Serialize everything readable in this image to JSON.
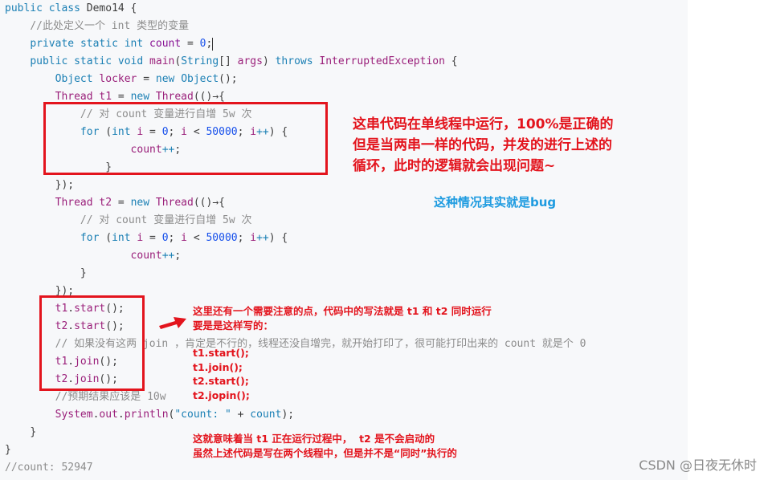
{
  "code": {
    "lines": [
      {
        "indent": 0,
        "tokens": [
          [
            "kw2",
            "public "
          ],
          [
            "kw2",
            "class "
          ],
          [
            "pl",
            "Demo14 {"
          ]
        ]
      },
      {
        "indent": 1,
        "tokens": [
          [
            "cm",
            "//此处定义一个 int 类型的变量"
          ]
        ]
      },
      {
        "indent": 1,
        "tokens": [
          [
            "kw2",
            "private "
          ],
          [
            "kw2",
            "static "
          ],
          [
            "kw2",
            "int "
          ],
          [
            "fld",
            "count"
          ],
          [
            "pl",
            " = "
          ],
          [
            "num",
            "0"
          ],
          [
            "pl",
            ";"
          ]
        ],
        "caret": true
      },
      {
        "indent": 1,
        "tokens": [
          [
            "kw2",
            "public "
          ],
          [
            "kw2",
            "static "
          ],
          [
            "kw2",
            "void "
          ],
          [
            "ty",
            "main"
          ],
          [
            "pl",
            "("
          ],
          [
            "kw2",
            "String"
          ],
          [
            "pl",
            "[] "
          ],
          [
            "ty",
            "args"
          ],
          [
            "pl",
            ") "
          ],
          [
            "kw2",
            "throws "
          ],
          [
            "ty",
            "InterruptedException"
          ],
          [
            "pl",
            " {"
          ]
        ]
      },
      {
        "indent": 2,
        "tokens": [
          [
            "kw2",
            "Object "
          ],
          [
            "ty",
            "locker"
          ],
          [
            "pl",
            " = "
          ],
          [
            "kw2",
            "new "
          ],
          [
            "kw2",
            "Object"
          ],
          [
            "pl",
            "();"
          ]
        ]
      },
      {
        "indent": 2,
        "tokens": [
          [
            "ty",
            "Thread "
          ],
          [
            "ty",
            "t1"
          ],
          [
            "pl",
            " = "
          ],
          [
            "kw2",
            "new "
          ],
          [
            "ty",
            "Thread"
          ],
          [
            "pl",
            "(()→{"
          ]
        ]
      },
      {
        "indent": 3,
        "tokens": [
          [
            "cm",
            "// 对 count 变量进行自增 5w 次"
          ]
        ]
      },
      {
        "indent": 3,
        "tokens": [
          [
            "kw2",
            "for "
          ],
          [
            "pl",
            "("
          ],
          [
            "kw2",
            "int "
          ],
          [
            "ty",
            "i"
          ],
          [
            "pl",
            " = "
          ],
          [
            "num",
            "0"
          ],
          [
            "pl",
            "; "
          ],
          [
            "ty",
            "i"
          ],
          [
            "pl",
            " < "
          ],
          [
            "num",
            "50000"
          ],
          [
            "pl",
            "; "
          ],
          [
            "ty",
            "i"
          ],
          [
            "kw2",
            "++"
          ],
          [
            "pl",
            ") {"
          ]
        ]
      },
      {
        "indent": 5,
        "tokens": [
          [
            "ty",
            "count"
          ],
          [
            "kw2",
            "++"
          ],
          [
            "pl",
            ";"
          ]
        ]
      },
      {
        "indent": 4,
        "tokens": [
          [
            "pl",
            "}"
          ]
        ]
      },
      {
        "indent": 2,
        "tokens": [
          [
            "pl",
            "});"
          ]
        ]
      },
      {
        "indent": 2,
        "tokens": [
          [
            "ty",
            "Thread "
          ],
          [
            "ty",
            "t2"
          ],
          [
            "pl",
            " = "
          ],
          [
            "kw2",
            "new "
          ],
          [
            "ty",
            "Thread"
          ],
          [
            "pl",
            "(()→{"
          ]
        ]
      },
      {
        "indent": 3,
        "tokens": [
          [
            "cm",
            "// 对 count 变量进行自增 5w 次"
          ]
        ]
      },
      {
        "indent": 3,
        "tokens": [
          [
            "kw2",
            "for "
          ],
          [
            "pl",
            "("
          ],
          [
            "kw2",
            "int "
          ],
          [
            "ty",
            "i"
          ],
          [
            "pl",
            " = "
          ],
          [
            "num",
            "0"
          ],
          [
            "pl",
            "; "
          ],
          [
            "ty",
            "i"
          ],
          [
            "pl",
            " < "
          ],
          [
            "num",
            "50000"
          ],
          [
            "pl",
            "; "
          ],
          [
            "ty",
            "i"
          ],
          [
            "kw2",
            "++"
          ],
          [
            "pl",
            ") {"
          ]
        ]
      },
      {
        "indent": 5,
        "tokens": [
          [
            "ty",
            "count"
          ],
          [
            "kw2",
            "++"
          ],
          [
            "pl",
            ";"
          ]
        ]
      },
      {
        "indent": 3,
        "tokens": [
          [
            "pl",
            "}"
          ]
        ]
      },
      {
        "indent": 2,
        "tokens": [
          [
            "pl",
            "});"
          ]
        ]
      },
      {
        "indent": 2,
        "tokens": [
          [
            "ty",
            "t1"
          ],
          [
            "pl",
            "."
          ],
          [
            "ty",
            "start"
          ],
          [
            "pl",
            "();"
          ]
        ]
      },
      {
        "indent": 2,
        "tokens": [
          [
            "ty",
            "t2"
          ],
          [
            "pl",
            "."
          ],
          [
            "ty",
            "start"
          ],
          [
            "pl",
            "();"
          ]
        ]
      },
      {
        "indent": 2,
        "tokens": [
          [
            "cm",
            "// 如果没有这两 join ，肯定是不行的，线程还没自增完，就开始打印了，很可能打印出来的 count 就是个 0"
          ]
        ]
      },
      {
        "indent": 2,
        "tokens": [
          [
            "ty",
            "t1"
          ],
          [
            "pl",
            "."
          ],
          [
            "ty",
            "join"
          ],
          [
            "pl",
            "();"
          ]
        ]
      },
      {
        "indent": 2,
        "tokens": [
          [
            "ty",
            "t2"
          ],
          [
            "pl",
            "."
          ],
          [
            "ty",
            "join"
          ],
          [
            "pl",
            "();"
          ]
        ]
      },
      {
        "indent": 2,
        "tokens": [
          [
            "cm",
            "//预期结果应该是 10w"
          ]
        ]
      },
      {
        "indent": 2,
        "tokens": [
          [
            "ty",
            "System"
          ],
          [
            "pl",
            "."
          ],
          [
            "ty",
            "out"
          ],
          [
            "pl",
            "."
          ],
          [
            "ty",
            "println"
          ],
          [
            "pl",
            "("
          ],
          [
            "kw2",
            "\"count: \""
          ],
          [
            "pl",
            " + "
          ],
          [
            "kw2",
            "count"
          ],
          [
            "pl",
            ");"
          ]
        ]
      },
      {
        "indent": 1,
        "tokens": [
          [
            "pl",
            "}"
          ]
        ]
      },
      {
        "indent": 0,
        "tokens": [
          [
            "pl",
            "}"
          ]
        ]
      },
      {
        "indent": 0,
        "tokens": [
          [
            "cm",
            "//count: 52947"
          ]
        ]
      }
    ]
  },
  "annotations": {
    "note1": "这串代码在单线程中运行，100%是正确的\n但是当两串一样的代码，并发的进行上述的\n循环，此时的逻辑就会出现问题~",
    "note_bug": "这种情况其实就是bug",
    "note2": "这里还有一个需要注意的点，代码中的写法就是 t1 和 t2 同时运行\n要是是这样写的：",
    "note2_code": "t1.start();\nt1.join();\nt2.start();\nt2.jopin();",
    "note3": "这就意味着当 t1 正在运行过程中，  t2 是不会启动的\n虽然上述代码是写在两个线程中，但是并不是“同时”执行的"
  },
  "colors": {
    "annotation_red": "#e3141d",
    "annotation_blue": "#1e9be0",
    "panel_bg": "#f7f8fa"
  },
  "watermark": "CSDN @日夜无休时"
}
